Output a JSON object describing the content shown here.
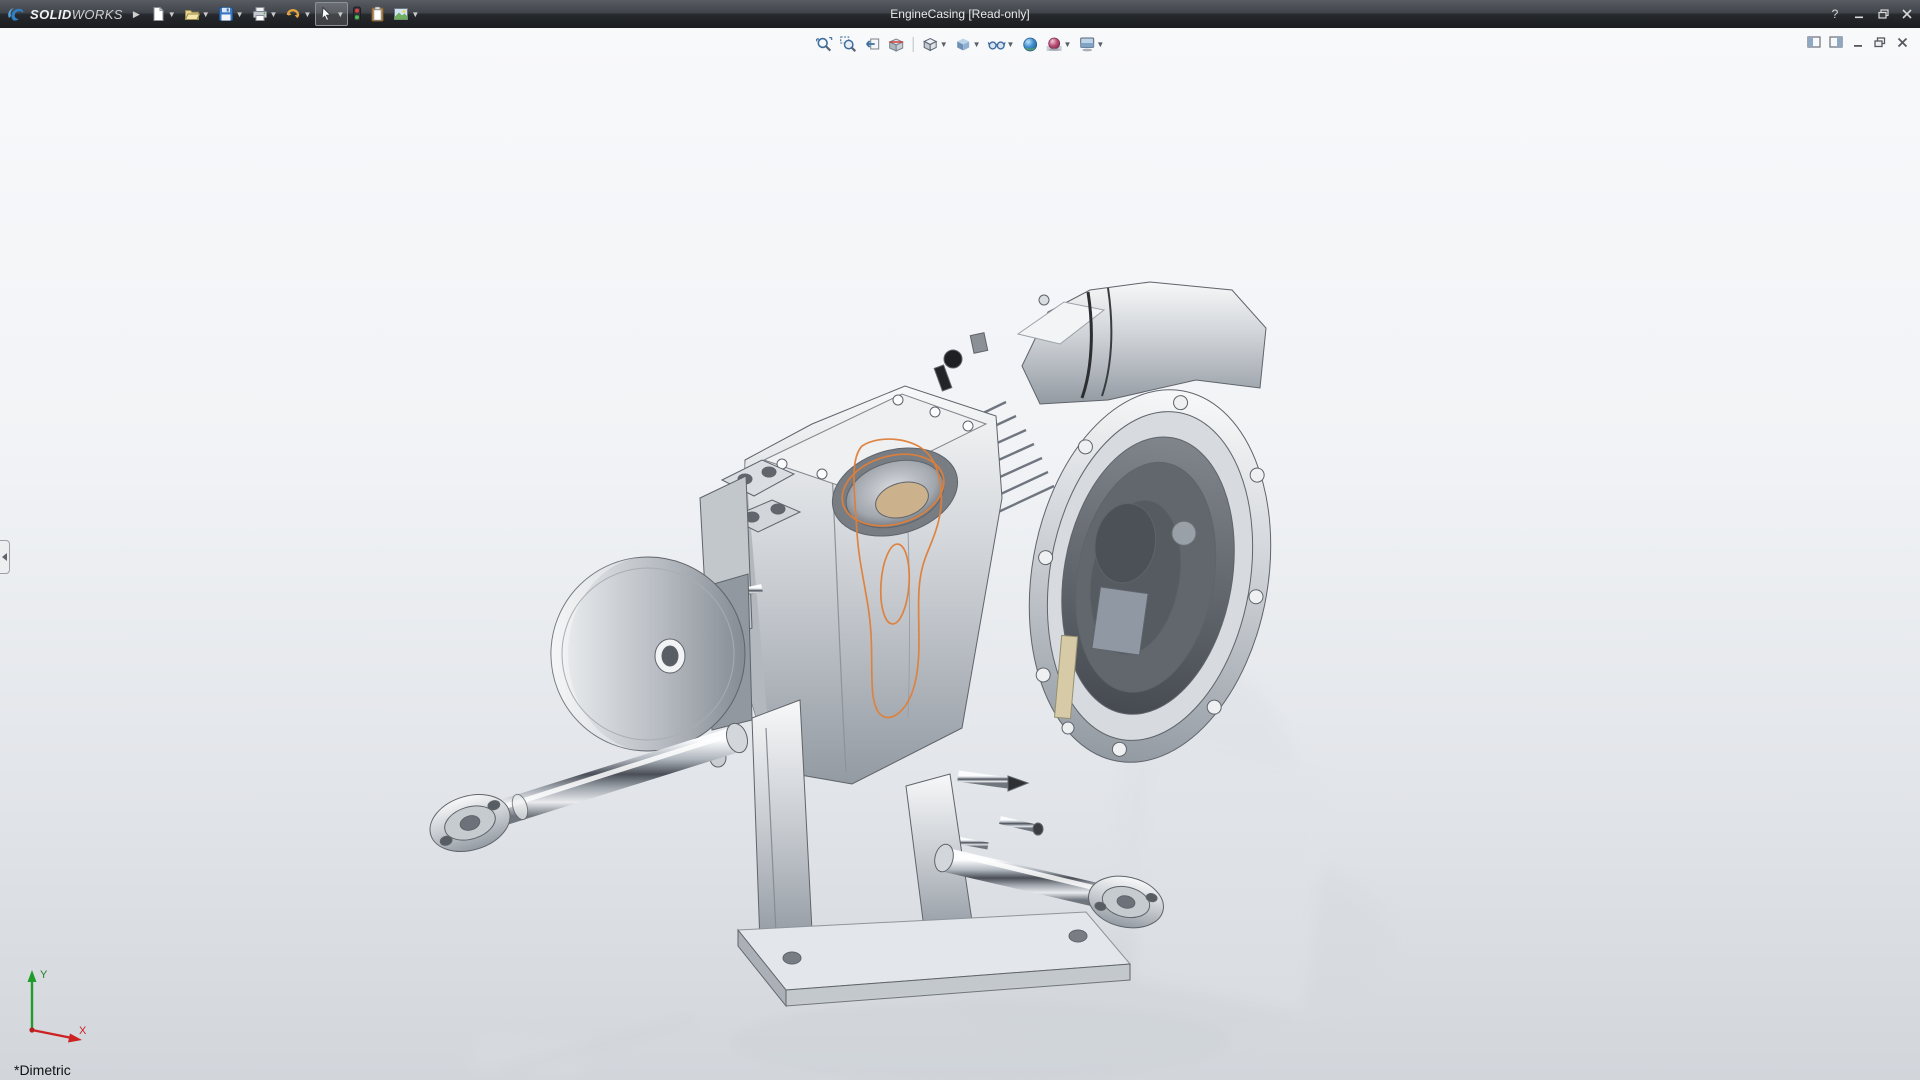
{
  "window": {
    "title": "EngineCasing [Read-only]",
    "logo": {
      "brand_bold": "SOLID",
      "brand_light": "WORKS"
    },
    "controls": {
      "help_glyph": "?",
      "minimize": "minimize",
      "restore": "restore",
      "close": "close"
    }
  },
  "main_toolbar": {
    "tools": [
      {
        "name": "new-document",
        "dropdown": true
      },
      {
        "name": "open-document",
        "dropdown": true
      },
      {
        "name": "save",
        "dropdown": true
      },
      {
        "name": "print",
        "dropdown": true
      },
      {
        "name": "undo",
        "dropdown": true
      },
      {
        "name": "select",
        "dropdown": true,
        "active": true
      },
      {
        "name": "rebuild-indicator",
        "dropdown": false
      },
      {
        "name": "properties-clipboard",
        "dropdown": false
      },
      {
        "name": "options",
        "dropdown": true
      }
    ]
  },
  "heads_up_toolbar": {
    "tools": [
      {
        "name": "zoom-to-fit"
      },
      {
        "name": "zoom-to-area"
      },
      {
        "name": "previous-view"
      },
      {
        "name": "section-view"
      },
      {
        "name": "view-orientation",
        "dropdown": true
      },
      {
        "name": "display-style",
        "dropdown": true
      },
      {
        "name": "hide-show-items",
        "dropdown": true
      },
      {
        "name": "edit-appearance"
      },
      {
        "name": "apply-scene",
        "dropdown": true
      },
      {
        "name": "view-settings",
        "dropdown": true
      }
    ]
  },
  "document_window_controls": [
    "window-left",
    "window-right",
    "minimize",
    "restore",
    "close"
  ],
  "viewport": {
    "view_orientation_label": "*Dimetric",
    "model_name": "EngineCasing",
    "triad": {
      "x_label": "X",
      "y_label": "Y"
    }
  },
  "colors": {
    "titlebar_top": "#585c63",
    "titlebar_bottom": "#1b1d20",
    "viewport_top": "#f8f9fb",
    "viewport_bottom": "#d2d6db",
    "sketch_orange": "#df7f39",
    "triad_x_red": "#cc2222",
    "triad_y_green": "#1f9d2c",
    "save_blue": "#3a76c4"
  }
}
